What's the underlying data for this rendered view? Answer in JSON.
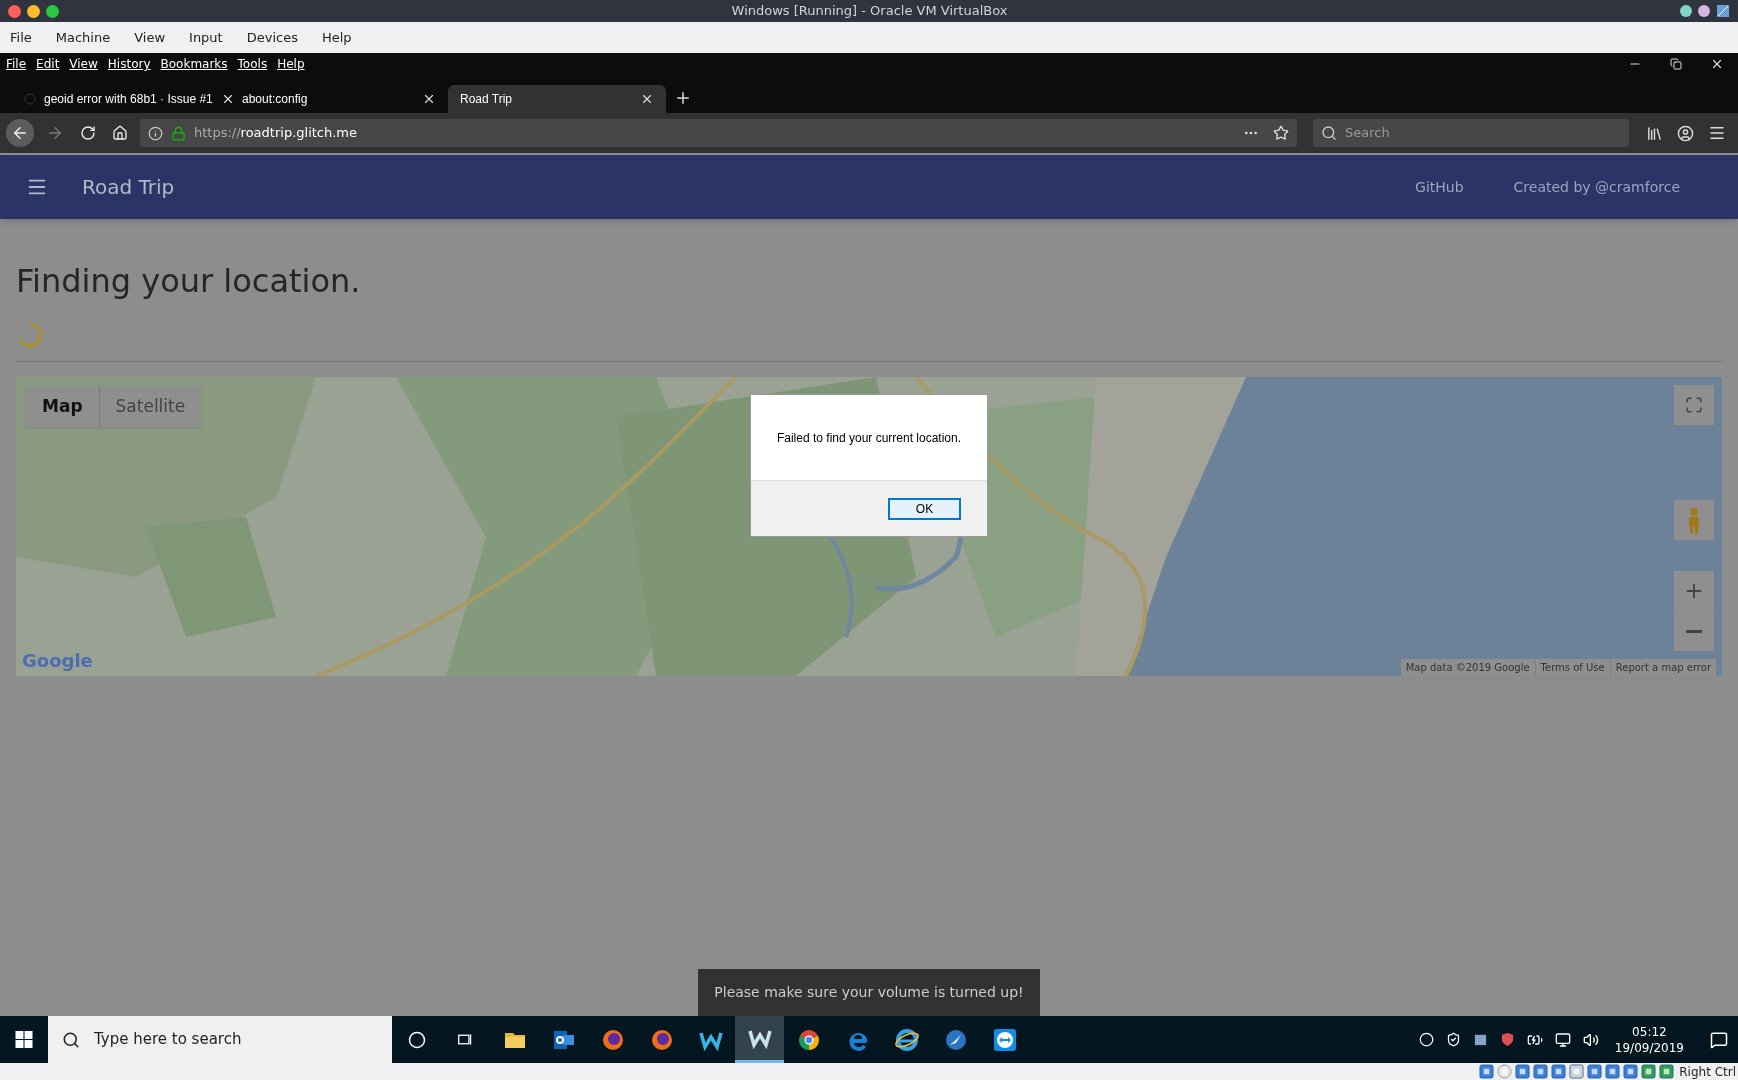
{
  "host_window": {
    "title": "Windows [Running] - Oracle VM VirtualBox",
    "menu": [
      "File",
      "Machine",
      "View",
      "Input",
      "Devices",
      "Help"
    ],
    "host_key": "Right Ctrl"
  },
  "browser": {
    "menu": [
      "File",
      "Edit",
      "View",
      "History",
      "Bookmarks",
      "Tools",
      "Help"
    ],
    "tabs": [
      {
        "title": "geoid error with 68b1 · Issue #1",
        "selected": false
      },
      {
        "title": "about:config",
        "selected": false
      },
      {
        "title": "Road Trip",
        "selected": true
      }
    ],
    "address_scheme": "https://",
    "address_host": "roadtrip.glitch.me",
    "search_placeholder": "Search"
  },
  "app": {
    "title": "Road Trip",
    "links": [
      "GitHub",
      "Created by @cramforce"
    ],
    "heading": "Finding your location.",
    "map": {
      "types": [
        {
          "label": "Map",
          "selected": true
        },
        {
          "label": "Satellite",
          "selected": false
        }
      ],
      "logo": "Google",
      "footer": [
        "Map data ©2019 Google",
        "Terms of Use",
        "Report a map error"
      ]
    }
  },
  "dialog": {
    "message": "Failed to find your current location.",
    "button": "OK"
  },
  "snackbar": "Please make sure your volume is turned up!",
  "taskbar": {
    "search_placeholder": "Type here to search",
    "time": "05:12",
    "date": "19/09/2019"
  }
}
